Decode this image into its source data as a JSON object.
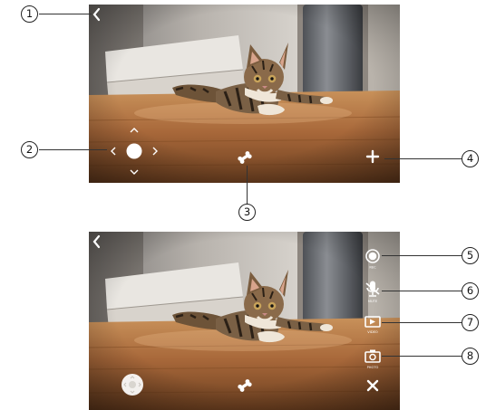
{
  "figure": {
    "callouts": [
      "1",
      "2",
      "3",
      "4",
      "5",
      "6",
      "7",
      "8"
    ]
  },
  "colors": {
    "overlay_icon": "#ffffff",
    "record_fill": "#ffffff",
    "callout_line": "#333333"
  },
  "live_view": {
    "controls": {
      "back": "chevron-left-icon",
      "direction_pad": "joystick-icon",
      "treat_toss": "bone-icon",
      "expand_menu": "plus-icon"
    }
  },
  "expanded_view": {
    "controls": {
      "back": "chevron-left-icon",
      "joystick": "joystick-icon",
      "treat_toss": "bone-icon",
      "close_menu": "close-icon"
    },
    "menu": [
      {
        "id": "record",
        "icon": "record-icon",
        "label": "REC"
      },
      {
        "id": "mute",
        "icon": "mic-mute-icon",
        "label": "MUTE"
      },
      {
        "id": "video",
        "icon": "video-icon",
        "label": "VIDEO"
      },
      {
        "id": "photo",
        "icon": "camera-icon",
        "label": "PHOTO"
      }
    ]
  }
}
